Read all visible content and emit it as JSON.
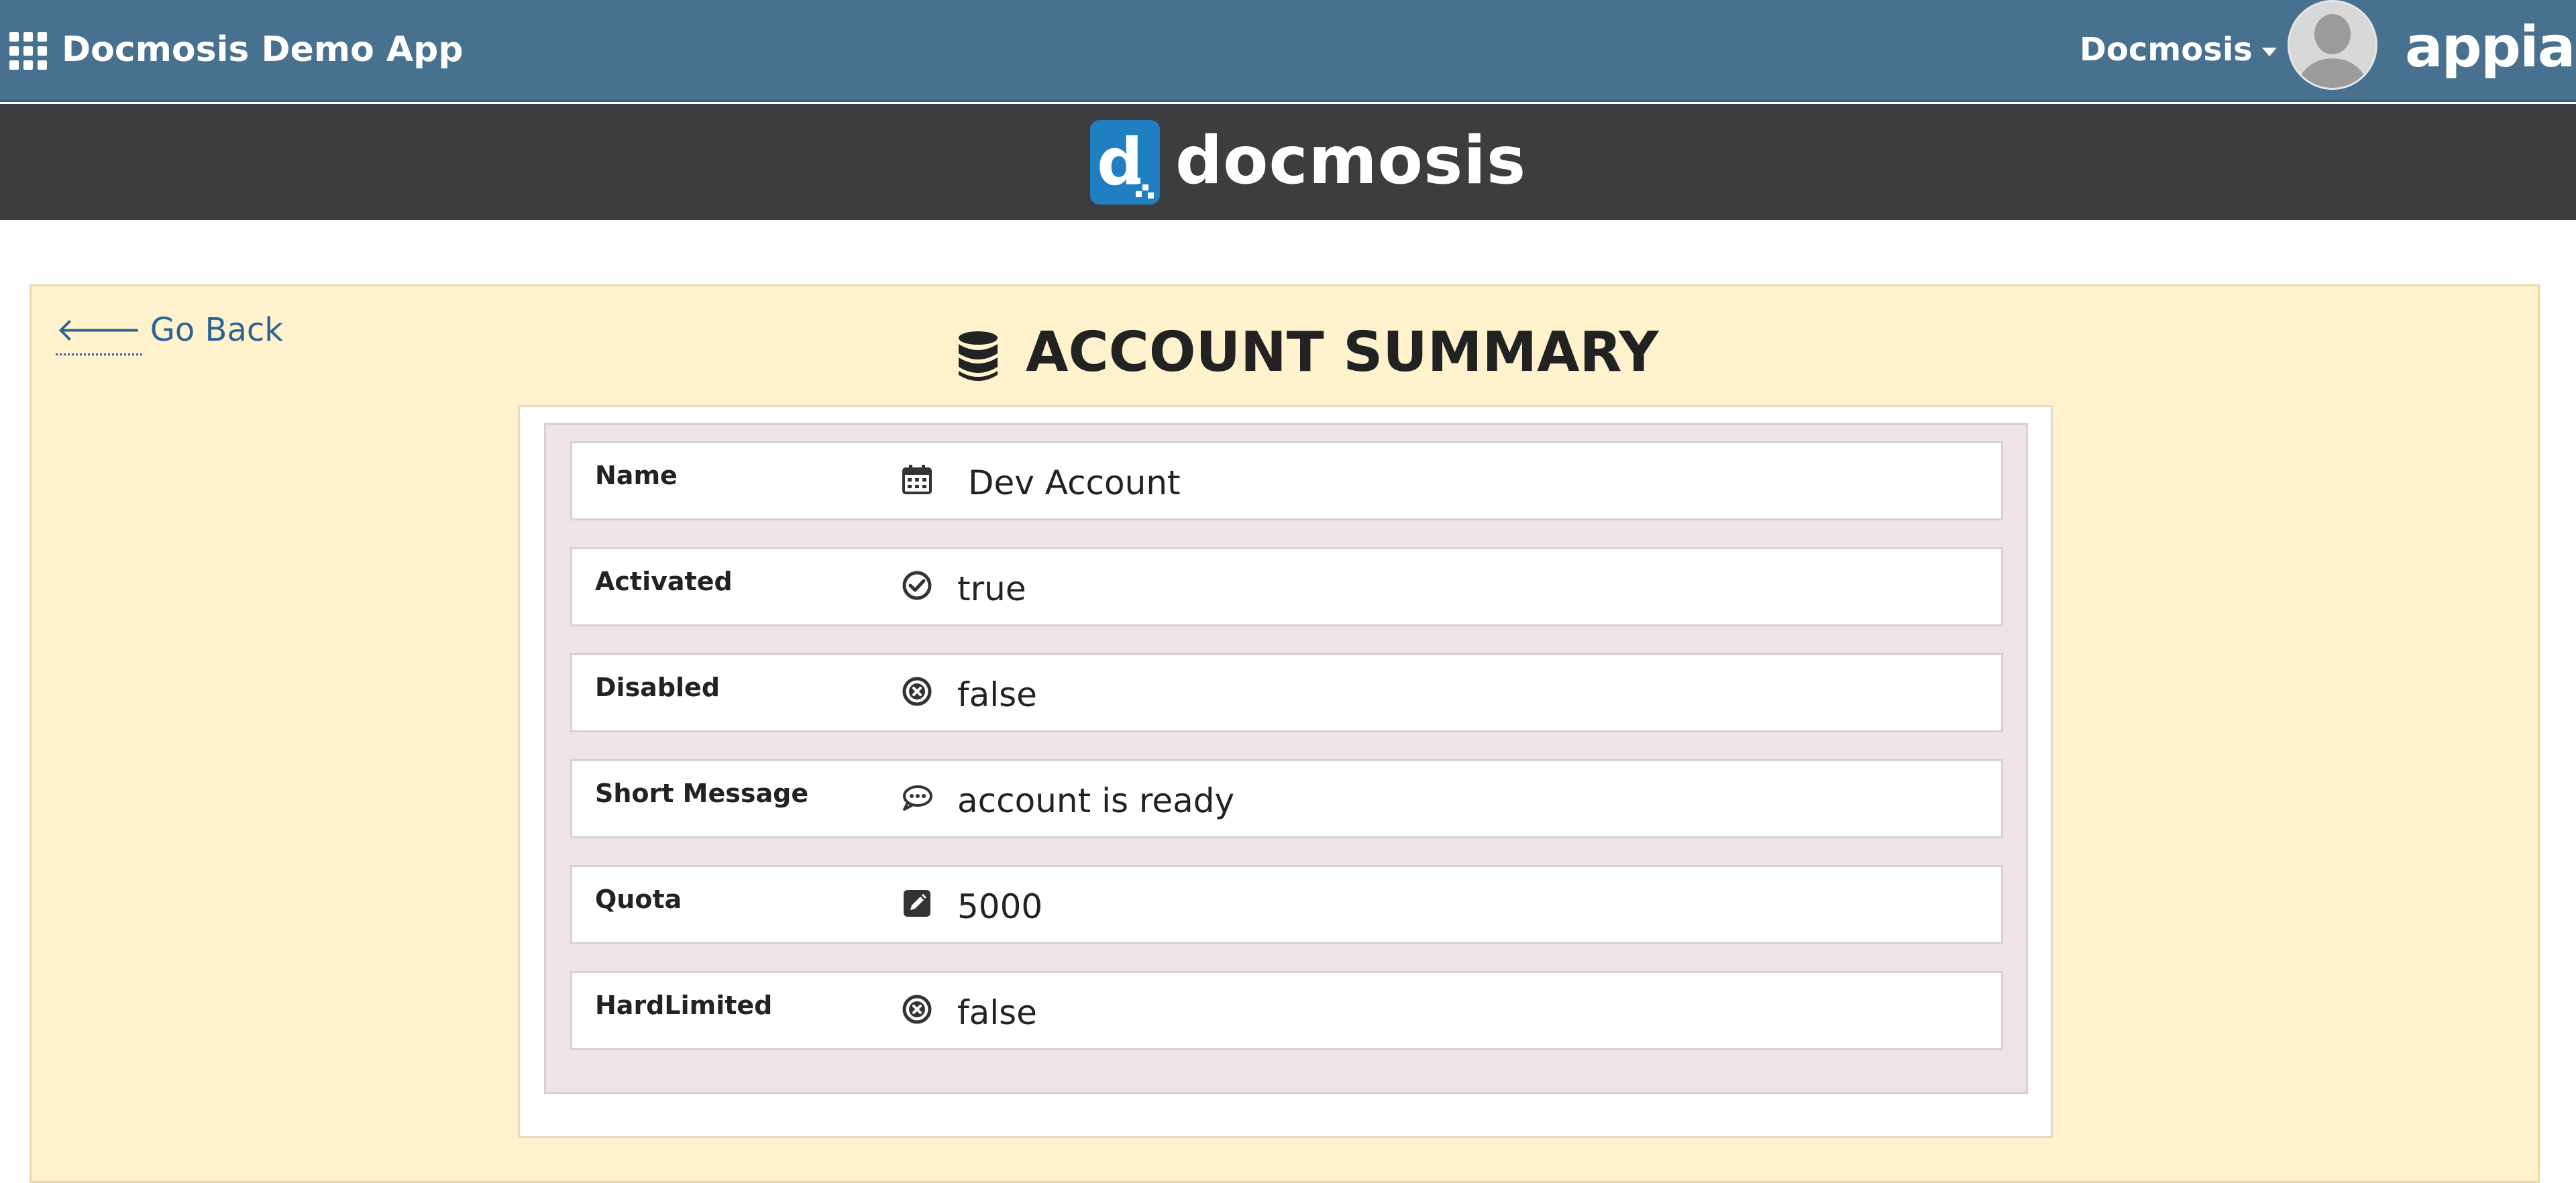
{
  "topbar": {
    "app_title": "Docmosis Demo App",
    "user_menu_label": "Docmosis",
    "brand_logo": "appian",
    "bar_color": "#48708f"
  },
  "banner": {
    "logo_text": "docmosis",
    "logo_mark_letter": "d",
    "logo_color": "#1f7fc1",
    "background": "#3c3d3f"
  },
  "main": {
    "go_back_arrow": "🡐",
    "go_back_label": "Go Back",
    "heading": "ACCOUNT SUMMARY",
    "heading_icon": "database-icon",
    "panel_background": "#fff2cc",
    "rows": [
      {
        "label": "Name",
        "icon": "calendar-icon",
        "value": "Dev Account"
      },
      {
        "label": "Activated",
        "icon": "check-circle-icon",
        "value": "true"
      },
      {
        "label": "Disabled",
        "icon": "times-circle-icon",
        "value": "false"
      },
      {
        "label": "Short Message",
        "icon": "comment-icon",
        "value": "account is ready"
      },
      {
        "label": "Quota",
        "icon": "edit-icon",
        "value": "5000"
      },
      {
        "label": "HardLimited",
        "icon": "times-circle-icon",
        "value": "false"
      }
    ]
  }
}
